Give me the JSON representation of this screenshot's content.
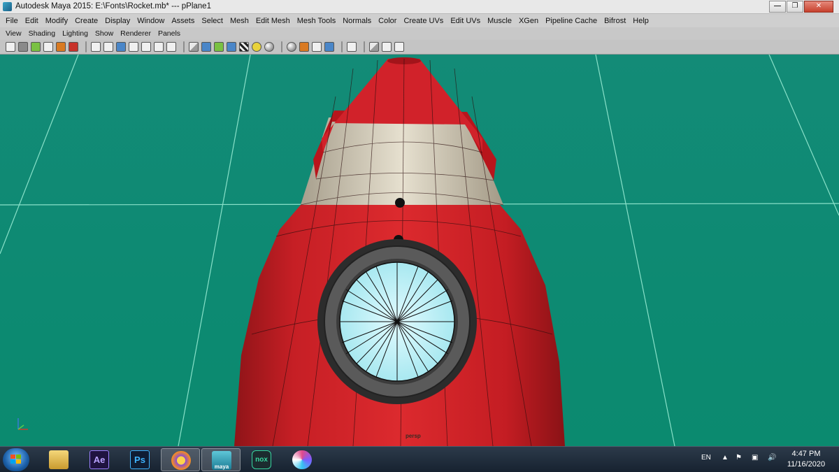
{
  "window": {
    "title": "Autodesk Maya 2015: E:\\Fonts\\Rocket.mb*   ---   pPlane1",
    "minimize_glyph": "—",
    "maximize_glyph": "❐",
    "close_glyph": "✕"
  },
  "menubar": {
    "items": [
      "File",
      "Edit",
      "Modify",
      "Create",
      "Display",
      "Window",
      "Assets",
      "Select",
      "Mesh",
      "Edit Mesh",
      "Mesh Tools",
      "Normals",
      "Color",
      "Create UVs",
      "Edit UVs",
      "Muscle",
      "XGen",
      "Pipeline Cache",
      "Bifrost",
      "Help"
    ]
  },
  "panel_menu": {
    "items": [
      "View",
      "Shading",
      "Lighting",
      "Show",
      "Renderer",
      "Panels"
    ]
  },
  "viewport": {
    "camera_label": "persp",
    "background_color": "#0e8a73",
    "grid_color": "#9ff0d8",
    "rocket_body_color": "#d8242b",
    "nose_band_color": "#ddd6c4",
    "window_glass_color": "#bff3f7",
    "window_ring_color": "#4a4a4a"
  },
  "taskbar": {
    "apps": [
      {
        "name": "File Explorer",
        "label": ""
      },
      {
        "name": "Adobe After Effects",
        "label": "Ae"
      },
      {
        "name": "Adobe Photoshop",
        "label": "Ps"
      },
      {
        "name": "Browser",
        "label": ""
      },
      {
        "name": "Autodesk Maya",
        "label": "maya"
      },
      {
        "name": "Nox Player",
        "label": "nox"
      },
      {
        "name": "Color app",
        "label": ""
      }
    ],
    "language": "EN",
    "time": "4:47 PM",
    "date": "11/16/2020"
  }
}
